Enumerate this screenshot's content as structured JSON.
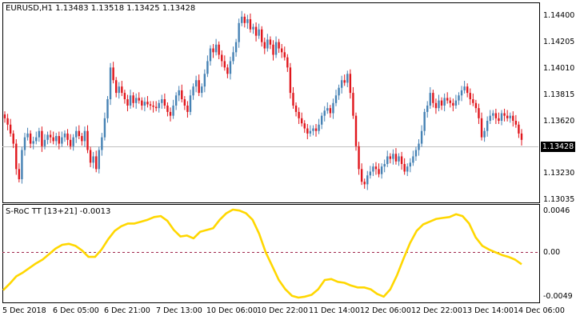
{
  "chart": {
    "symbol_header": "EURUSD,H1",
    "ohlc": [
      "1.13483",
      "1.13518",
      "1.13425",
      "1.13428"
    ],
    "current_price": "1.13428",
    "indicator_header": "S-RoC TT [13+21] -0.0013",
    "price_labels": [
      "1.14400",
      "1.14205",
      "1.14010",
      "1.13815",
      "1.13620",
      "1.13230",
      "1.13035"
    ],
    "indicator_labels": [
      "0.0046",
      "0.00",
      "-0.0049"
    ],
    "time_labels": [
      "5 Dec 2018",
      "6 Dec 05:00",
      "6 Dec 21:00",
      "7 Dec 13:00",
      "10 Dec 06:00",
      "10 Dec 22:00",
      "11 Dec 14:00",
      "12 Dec 06:00",
      "12 Dec 22:00",
      "13 Dec 14:00",
      "14 Dec 06:00"
    ],
    "colors": {
      "bull": "#4682B4",
      "bear": "#E0161C",
      "indicator": "#FFD700",
      "zero_line": "#A0284C"
    }
  },
  "chart_data": [
    {
      "type": "candlestick",
      "title": "EURUSD,H1",
      "ylim": [
        1.1295,
        1.145
      ],
      "closes": [
        1.136,
        1.1355,
        1.1348,
        1.134,
        1.132,
        1.1312,
        1.1335,
        1.1345,
        1.1348,
        1.134,
        1.1342,
        1.1345,
        1.135,
        1.1338,
        1.1343,
        1.1347,
        1.1345,
        1.1342,
        1.1346,
        1.134,
        1.1345,
        1.1348,
        1.1343,
        1.1338,
        1.1345,
        1.135,
        1.1346,
        1.1342,
        1.135,
        1.1335,
        1.1325,
        1.133,
        1.132,
        1.1335,
        1.1345,
        1.136,
        1.1375,
        1.14,
        1.139,
        1.138,
        1.1385,
        1.138,
        1.1375,
        1.137,
        1.1378,
        1.1372,
        1.1376,
        1.1374,
        1.137,
        1.1373,
        1.1371,
        1.137,
        1.1369,
        1.1368,
        1.1372,
        1.1375,
        1.137,
        1.1365,
        1.1362,
        1.137,
        1.1378,
        1.1382,
        1.1375,
        1.137,
        1.1365,
        1.1378,
        1.1385,
        1.139,
        1.138,
        1.1385,
        1.1395,
        1.1405,
        1.1415,
        1.1412,
        1.1418,
        1.141,
        1.1405,
        1.14,
        1.1395,
        1.1405,
        1.1412,
        1.142,
        1.1435,
        1.144,
        1.1435,
        1.1438,
        1.143,
        1.1432,
        1.1425,
        1.143,
        1.142,
        1.1415,
        1.1422,
        1.1418,
        1.141,
        1.142,
        1.1415,
        1.1412,
        1.1408,
        1.14,
        1.138,
        1.137,
        1.1365,
        1.136,
        1.1356,
        1.1352,
        1.1348,
        1.135,
        1.1352,
        1.135,
        1.1355,
        1.1362,
        1.1366,
        1.1368,
        1.1364,
        1.1372,
        1.1378,
        1.1384,
        1.139,
        1.1388,
        1.1395,
        1.138,
        1.1362,
        1.1338,
        1.132,
        1.131,
        1.1308,
        1.1315,
        1.1318,
        1.1322,
        1.132,
        1.1316,
        1.1322,
        1.1324,
        1.133,
        1.1328,
        1.1332,
        1.1326,
        1.133,
        1.1324,
        1.1318,
        1.1322,
        1.1325,
        1.133,
        1.1335,
        1.134,
        1.135,
        1.1365,
        1.137,
        1.138,
        1.1372,
        1.1368,
        1.1374,
        1.137,
        1.1376,
        1.1374,
        1.1372,
        1.137,
        1.1374,
        1.1378,
        1.1382,
        1.1385,
        1.138,
        1.1375,
        1.1372,
        1.1368,
        1.136,
        1.1345,
        1.135,
        1.1358,
        1.1362,
        1.1364,
        1.136,
        1.1358,
        1.1364,
        1.1362,
        1.136,
        1.1362,
        1.1358,
        1.1355,
        1.1348,
        1.1343
      ]
    },
    {
      "type": "line",
      "title": "S-RoC TT [13+21]",
      "ylim": [
        -0.0049,
        0.0046
      ],
      "series": [
        {
          "name": "S-RoC TT [13+21]",
          "values": [
            -0.0041,
            -0.0034,
            -0.0026,
            -0.0022,
            -0.0017,
            -0.0012,
            -0.0008,
            -0.0002,
            0.0004,
            0.0008,
            0.0009,
            0.0007,
            0.0002,
            -0.0005,
            -0.0005,
            0.0003,
            0.0014,
            0.0023,
            0.0028,
            0.0031,
            0.0031,
            0.0033,
            0.0035,
            0.0038,
            0.0039,
            0.0034,
            0.0024,
            0.0017,
            0.0018,
            0.0015,
            0.0022,
            0.0024,
            0.0026,
            0.0035,
            0.0042,
            0.0046,
            0.0045,
            0.0042,
            0.0035,
            0.002,
            0.0,
            -0.0015,
            -0.003,
            -0.004,
            -0.0047,
            -0.0049,
            -0.0048,
            -0.0046,
            -0.004,
            -0.003,
            -0.0029,
            -0.0032,
            -0.0033,
            -0.0036,
            -0.0038,
            -0.0038,
            -0.004,
            -0.0045,
            -0.0048,
            -0.004,
            -0.0025,
            -0.0007,
            0.001,
            0.0023,
            0.003,
            0.0033,
            0.0036,
            0.0037,
            0.0038,
            0.0041,
            0.0039,
            0.0031,
            0.0016,
            0.0007,
            0.0003,
            0.0,
            -0.0003,
            -0.0005,
            -0.0008,
            -0.0013
          ]
        }
      ]
    }
  ]
}
